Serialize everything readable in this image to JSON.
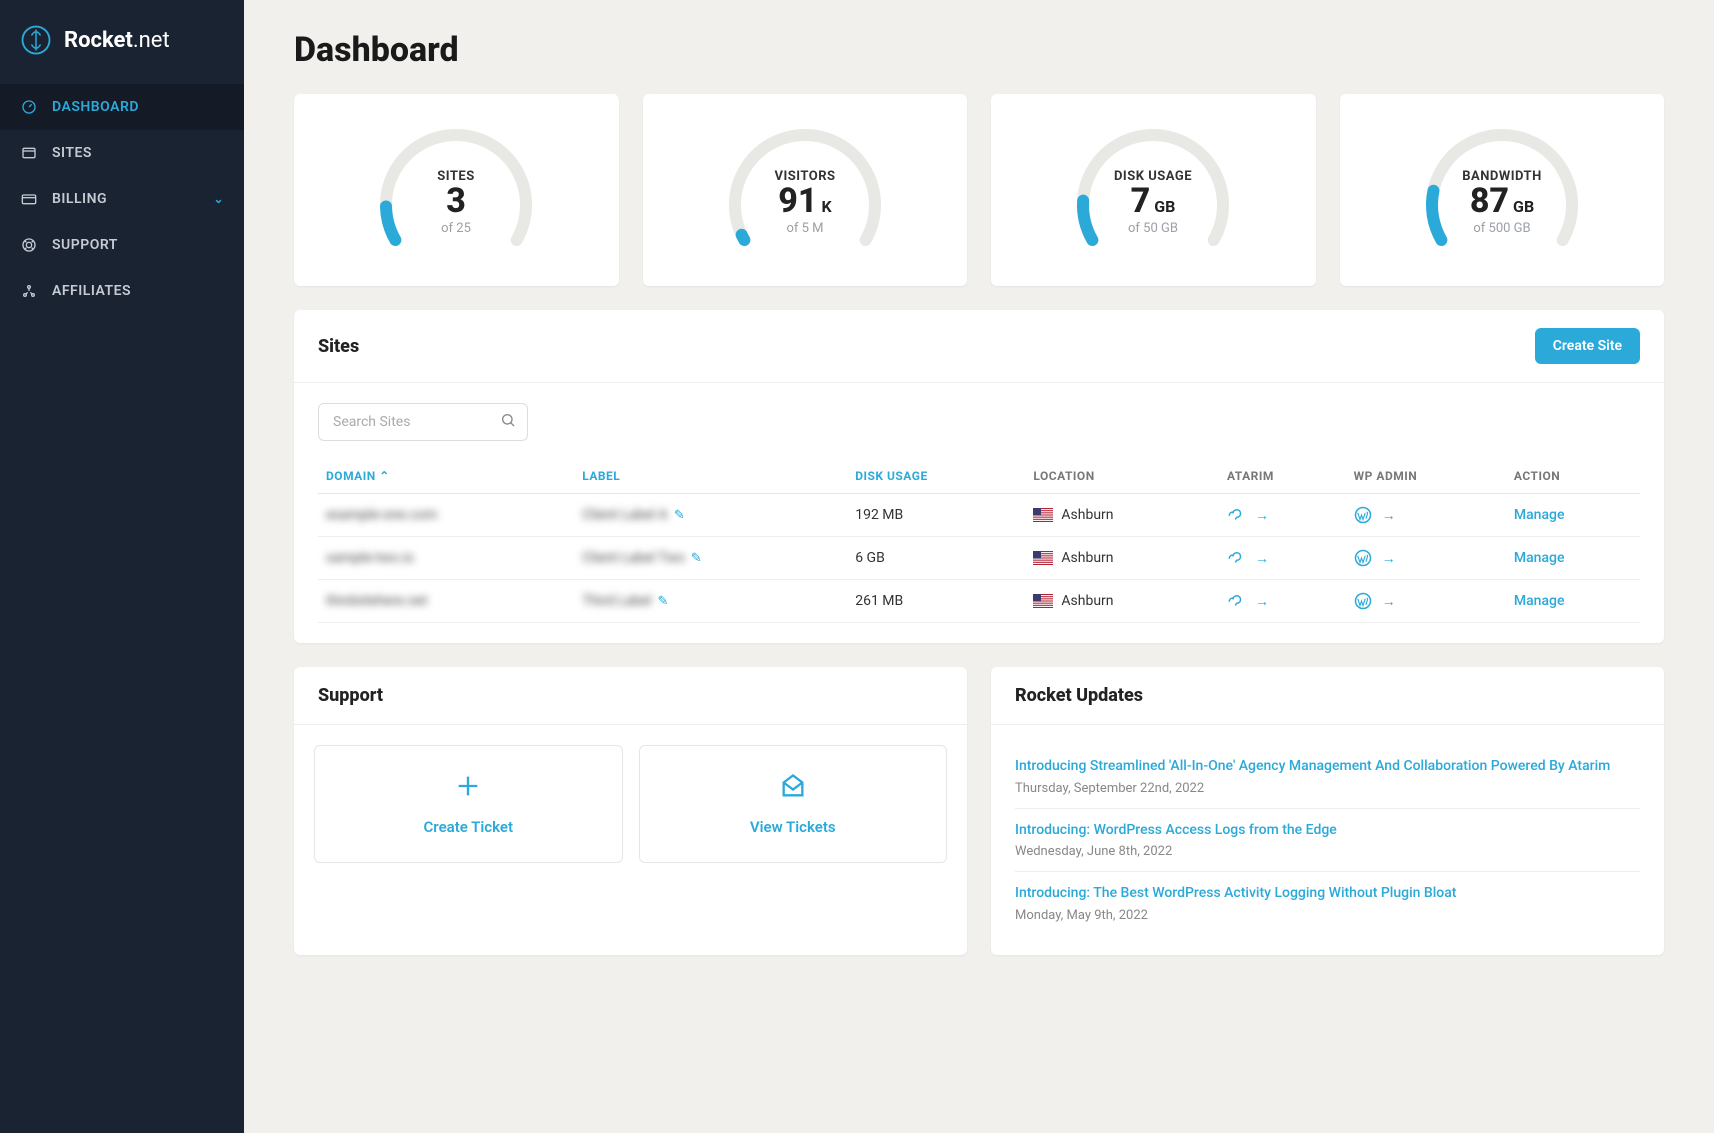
{
  "brand": {
    "name_bold": "Rocket",
    "name_thin": ".net"
  },
  "nav": {
    "items": [
      {
        "label": "DASHBOARD",
        "active": true
      },
      {
        "label": "SITES"
      },
      {
        "label": "BILLING",
        "expandable": true
      },
      {
        "label": "SUPPORT"
      },
      {
        "label": "AFFILIATES"
      }
    ]
  },
  "page_title": "Dashboard",
  "chart_data": [
    {
      "type": "gauge",
      "title": "SITES",
      "value": 3,
      "max": 25,
      "unit": "",
      "sub": "of 25"
    },
    {
      "type": "gauge",
      "title": "VISITORS",
      "value": 91,
      "max": 5000,
      "unit": "K",
      "sub": "of 5 M",
      "fraction": 0.018
    },
    {
      "type": "gauge",
      "title": "DISK USAGE",
      "value": 7,
      "max": 50,
      "unit": "GB",
      "sub": "of 50 GB"
    },
    {
      "type": "gauge",
      "title": "BANDWIDTH",
      "value": 87,
      "max": 500,
      "unit": "GB",
      "sub": "of 500 GB"
    }
  ],
  "sites_panel": {
    "heading": "Sites",
    "create_label": "Create Site",
    "search_placeholder": "Search Sites",
    "columns": {
      "domain": "DOMAIN",
      "label": "LABEL",
      "disk": "DISK USAGE",
      "location": "LOCATION",
      "atarim": "ATARIM",
      "wpadmin": "WP ADMIN",
      "action": "ACTION"
    },
    "rows": [
      {
        "domain": "example-one.com",
        "label": "Client Label A",
        "disk": "192 MB",
        "location": "Ashburn",
        "action": "Manage"
      },
      {
        "domain": "sample-two.io",
        "label": "Client Label Two",
        "disk": "6 GB",
        "location": "Ashburn",
        "action": "Manage"
      },
      {
        "domain": "thirdsitehere.net",
        "label": "Third Label",
        "disk": "261 MB",
        "location": "Ashburn",
        "action": "Manage"
      }
    ]
  },
  "support": {
    "heading": "Support",
    "create": "Create Ticket",
    "view": "View Tickets"
  },
  "updates": {
    "heading": "Rocket Updates",
    "items": [
      {
        "title": "Introducing Streamlined 'All-In-One' Agency Management And Collaboration Powered By Atarim",
        "date": "Thursday, September 22nd, 2022"
      },
      {
        "title": "Introducing: WordPress Access Logs from the Edge",
        "date": "Wednesday, June 8th, 2022"
      },
      {
        "title": "Introducing: The Best WordPress Activity Logging Without Plugin Bloat",
        "date": "Monday, May 9th, 2022"
      }
    ]
  }
}
